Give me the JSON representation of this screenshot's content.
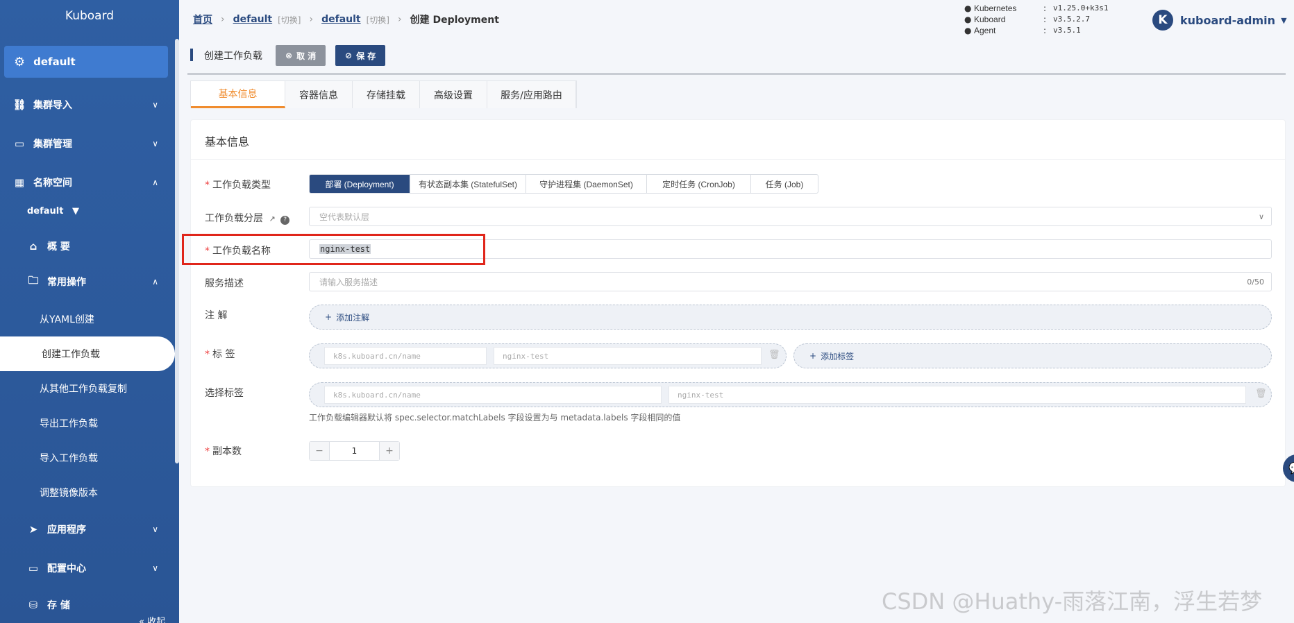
{
  "sidebar": {
    "logo": "Kuboard",
    "active_namespace": "default",
    "items": [
      {
        "label": "集群导入",
        "icon": "link-icon"
      },
      {
        "label": "集群管理",
        "icon": "briefcase-icon"
      },
      {
        "label": "名称空间",
        "icon": "grid-icon"
      }
    ],
    "namespace_selector": "default",
    "overview": "概 要",
    "common_ops": "常用操作",
    "sub_items": [
      "从YAML创建",
      "创建工作负载",
      "从其他工作负载复制",
      "导出工作负载",
      "导入工作负载",
      "调整镜像版本"
    ],
    "app": "应用程序",
    "config": "配置中心",
    "storage": "存 储",
    "collapse": "收起"
  },
  "breadcrumb": {
    "home": "首页",
    "cluster": "default",
    "switch1": "[切换]",
    "namespace": "default",
    "switch2": "[切换]",
    "current": "创建 Deployment"
  },
  "versions": [
    {
      "name": "Kubernetes",
      "value": "v1.25.0+k3s1"
    },
    {
      "name": "Kuboard",
      "value": "v3.5.2.7"
    },
    {
      "name": "Agent",
      "value": "v3.5.1"
    }
  ],
  "user": {
    "avatar": "K",
    "name": "kuboard-admin"
  },
  "toolbar": {
    "title": "创建工作负载",
    "cancel": "取 消",
    "save": "保 存"
  },
  "tabs": [
    "基本信息",
    "容器信息",
    "存储挂载",
    "高级设置",
    "服务/应用路由"
  ],
  "form": {
    "section_title": "基本信息",
    "workload_type_label": "工作负载类型",
    "workload_types": [
      "部署 (Deployment)",
      "有状态副本集 (StatefulSet)",
      "守护进程集 (DaemonSet)",
      "定时任务 (CronJob)",
      "任务 (Job)"
    ],
    "layer_label": "工作负载分层",
    "layer_placeholder": "空代表默认层",
    "name_label": "工作负载名称",
    "name_value": "nginx-test",
    "desc_label": "服务描述",
    "desc_placeholder": "请输入服务描述",
    "desc_count": "0/50",
    "annotation_label": "注 解",
    "add_annotation": "添加注解",
    "labels_label": "标 签",
    "label_key_placeholder": "k8s.kuboard.cn/name",
    "label_value_placeholder": "nginx-test",
    "add_label": "添加标签",
    "selector_label": "选择标签",
    "selector_key_placeholder": "k8s.kuboard.cn/name",
    "selector_value_placeholder": "nginx-test",
    "selector_hint": "工作负载编辑器默认将 spec.selector.matchLabels 字段设置为与 metadata.labels 字段相同的值",
    "replicas_label": "副本数",
    "replicas_value": "1"
  },
  "watermark": "CSDN @Huathy-雨落江南，浮生若梦"
}
